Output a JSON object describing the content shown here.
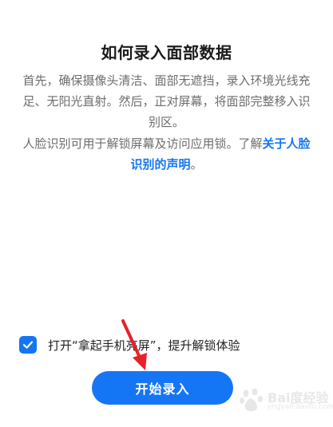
{
  "dialog": {
    "title": "如何录入面部数据",
    "description": "首先，确保摄像头清洁、面部无遮挡，录入环境光线充足、无阳光直射。然后，正对屏幕，将面部完整移入识别区。",
    "notice_prefix": "人脸识别可用于解锁屏幕及访问应用锁。了解",
    "notice_link": "关于人脸识别的声明",
    "notice_suffix": "。"
  },
  "option": {
    "label": "打开“拿起手机亮屏”，提升解锁体验",
    "checked": true
  },
  "primary_button": {
    "label": "开始录入"
  },
  "colors": {
    "accent": "#1476f5",
    "annotation_arrow": "#e8202a"
  },
  "icons": {
    "checkbox": "check-icon",
    "annotation": "red-arrow-annotation",
    "watermark": "baidu-jingyan-watermark"
  },
  "watermark": {
    "text": "Bai度经验",
    "sub": "jingyan.baidu.com"
  }
}
